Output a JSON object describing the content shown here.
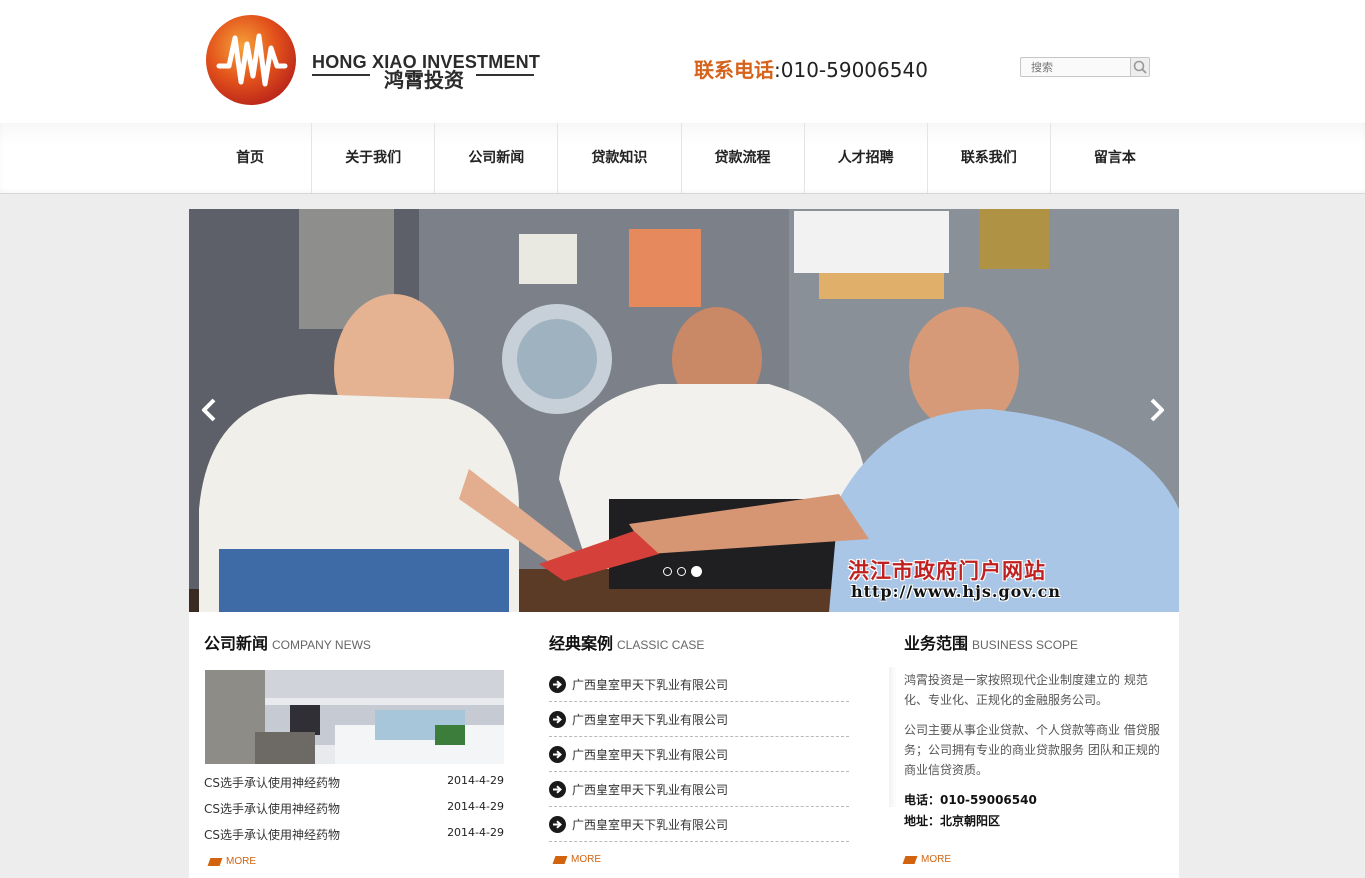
{
  "brand": {
    "name_en": "HONG XIAO INVESTMENT",
    "name_cn": "鸿霄投资"
  },
  "header": {
    "phone_label": "联系电话",
    "phone_number": ":010-59006540",
    "search_placeholder": "搜索"
  },
  "nav": {
    "items": [
      "首页",
      "关于我们",
      "公司新闻",
      "贷款知识",
      "贷款流程",
      "人才招聘",
      "联系我们",
      "留言本"
    ]
  },
  "banner": {
    "watermark_cn": "洪江市政府门户网站",
    "watermark_url": "http://www.hjs.gov.cn",
    "slide_count": 3,
    "active_slide": 3
  },
  "news": {
    "title_cn": "公司新闻",
    "title_en": "COMPANY NEWS",
    "items": [
      {
        "title": "CS选手承认使用神经药物",
        "date": "2014-4-29"
      },
      {
        "title": "CS选手承认使用神经药物",
        "date": "2014-4-29"
      },
      {
        "title": "CS选手承认使用神经药物",
        "date": "2014-4-29"
      }
    ],
    "more": "MORE"
  },
  "cases": {
    "title_cn": "经典案例",
    "title_en": "CLASSIC CASE",
    "items": [
      "广西皇室甲天下乳业有限公司",
      "广西皇室甲天下乳业有限公司",
      "广西皇室甲天下乳业有限公司",
      "广西皇室甲天下乳业有限公司",
      "广西皇室甲天下乳业有限公司"
    ],
    "more": "MORE"
  },
  "business": {
    "title_cn": "业务范围",
    "title_en": "BUSINESS SCOPE",
    "para1": "鸿霄投资是一家按照现代企业制度建立的 规范化、专业化、正规化的金融服务公司。",
    "para2": "公司主要从事企业贷款、个人贷款等商业 借贷服务；公司拥有专业的商业贷款服务 团队和正规的商业信贷资质。",
    "phone": "电话：010-59006540",
    "address": "地址：北京朝阳区",
    "more": "MORE"
  },
  "colors": {
    "accent": "#d6631c",
    "background": "#ededed"
  }
}
